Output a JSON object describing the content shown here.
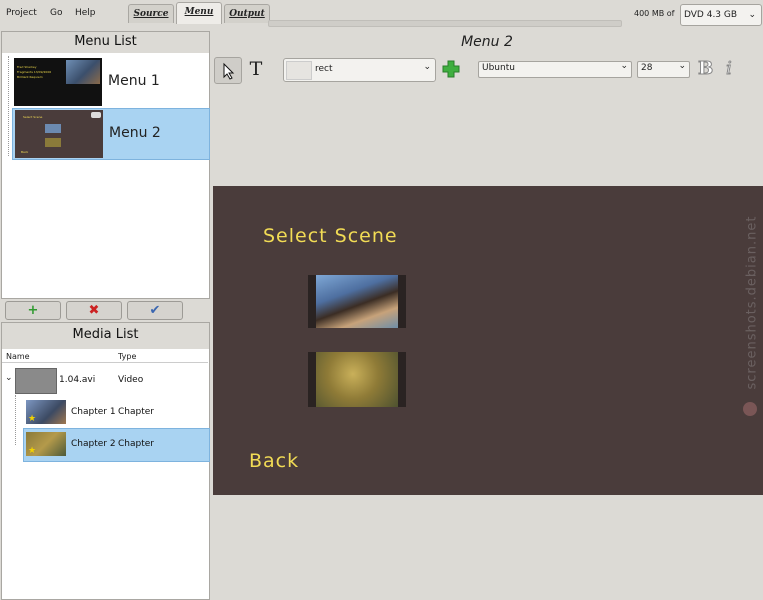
{
  "topmenu": {
    "project": "Project",
    "go": "Go",
    "help": "Help"
  },
  "tabs": [
    {
      "label": "Source"
    },
    {
      "label": "Menu"
    },
    {
      "label": "Output"
    }
  ],
  "size_label": "400 MB of",
  "dvd_select": "DVD 4.3 GB",
  "menu_list": {
    "title": "Menu List",
    "items": [
      {
        "label": "Menu 1",
        "thumb_text": [
          "Fred Sharkey",
          "Fragments 13/09/2006",
          "Brilliant Requiem"
        ]
      },
      {
        "label": "Menu 2",
        "thumb_text": [
          "Select Scene",
          "Back"
        ]
      }
    ]
  },
  "buttons": {
    "add": "+",
    "remove": "✖",
    "ok": "✔"
  },
  "media_list": {
    "title": "Media List",
    "col_name": "Name",
    "col_type": "Type",
    "rows": [
      {
        "name": "1.04.avi",
        "type": "Video"
      },
      {
        "name": "Chapter 1",
        "type": "Chapter"
      },
      {
        "name": "Chapter 2",
        "type": "Chapter"
      }
    ]
  },
  "editor": {
    "title": "Menu 2",
    "shape_value": "rect",
    "font_value": "Ubuntu",
    "size_value": "28",
    "bold_glyph": "B",
    "italic_glyph": "i",
    "text_tool_glyph": "T"
  },
  "canvas": {
    "heading": "Select Scene",
    "back": "Back",
    "watermark": "screenshots.debian.net"
  },
  "colors": {
    "canvas_bg": "#4a3c3b",
    "text_yellow": "#f2dc55",
    "selection": "#a9d3f2"
  }
}
